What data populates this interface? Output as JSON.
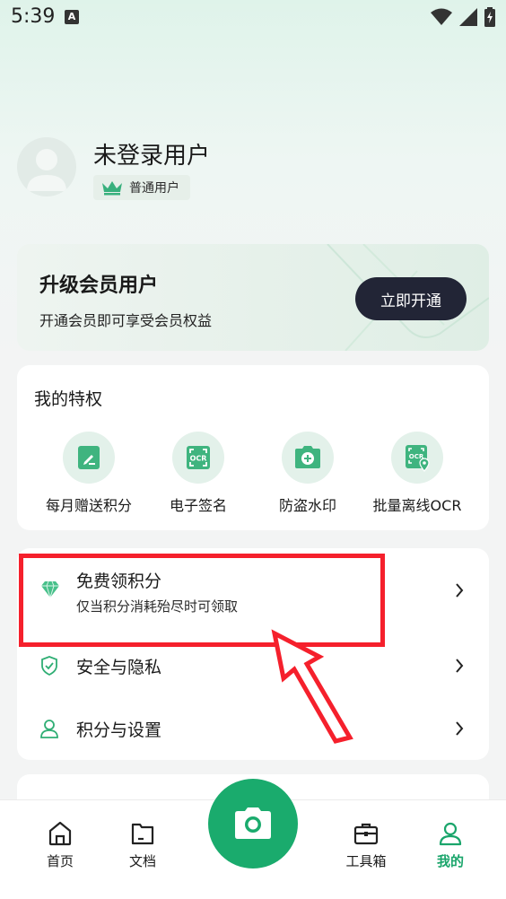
{
  "status": {
    "time": "5:39",
    "notif_letter": "A"
  },
  "profile": {
    "name": "未登录用户",
    "badge": "普通用户"
  },
  "vip": {
    "title": "升级会员用户",
    "desc": "开通会员即可享受会员权益",
    "button": "立即开通"
  },
  "privileges": {
    "title": "我的特权",
    "items": [
      {
        "label": "每月赠送积分",
        "icon": "edit-doc-icon"
      },
      {
        "label": "电子签名",
        "icon": "ocr-scan-icon"
      },
      {
        "label": "防盗水印",
        "icon": "camera-plus-icon"
      },
      {
        "label": "批量离线OCR",
        "icon": "ocr-location-icon"
      }
    ]
  },
  "menu": {
    "free_points": {
      "label": "免费领积分",
      "sub": "仅当积分消耗殆尽时可领取"
    },
    "security": {
      "label": "安全与隐私"
    },
    "settings": {
      "label": "积分与设置"
    }
  },
  "nav": {
    "home": "首页",
    "docs": "文档",
    "tools": "工具箱",
    "mine": "我的"
  },
  "colors": {
    "accent": "#1aab6d",
    "annotation": "#f5202c",
    "vip_button": "#222536"
  }
}
